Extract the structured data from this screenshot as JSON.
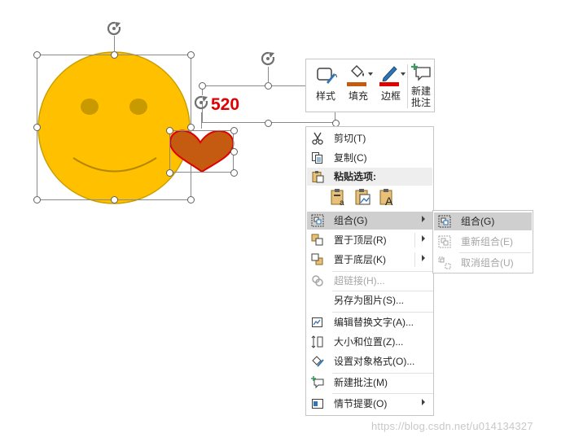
{
  "canvas": {
    "text_box_label": "520",
    "text_box_color": "#e00000"
  },
  "shapes": {
    "smiley": {
      "fill": "#ffc000",
      "stroke": "#c9a000"
    },
    "heart": {
      "fill": "#c55a11",
      "stroke": "#e00000"
    }
  },
  "mini_toolbar": {
    "style_label": "样式",
    "fill_label": "填充",
    "border_label": "边框",
    "comment_label": "新建\n批注",
    "fill_color": "#c55a11",
    "border_color": "#e00000"
  },
  "context_menu": {
    "cut": "剪切(T)",
    "copy": "复制(C)",
    "paste_options": "粘贴选项:",
    "group": "组合(G)",
    "bring_front": "置于顶层(R)",
    "send_back": "置于底层(K)",
    "hyperlink": "超链接(H)...",
    "save_as_picture": "另存为图片(S)...",
    "edit_alt_text": "编辑替换文字(A)...",
    "size_position": "大小和位置(Z)...",
    "format_object": "设置对象格式(O)...",
    "new_comment": "新建批注(M)",
    "storyline": "情节提要(O)"
  },
  "group_submenu": {
    "group": "组合(G)",
    "regroup": "重新组合(E)",
    "ungroup": "取消组合(U)"
  },
  "watermark": "https://blog.csdn.net/u014134327"
}
